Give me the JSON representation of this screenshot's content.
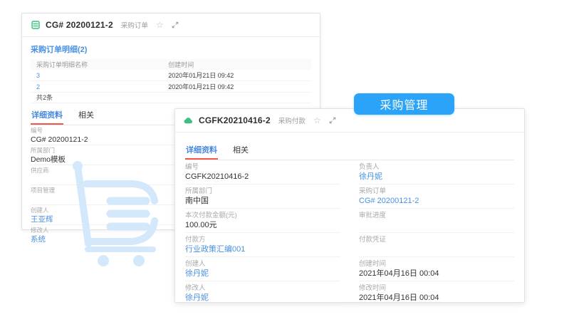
{
  "badge": {
    "label": "采购管理",
    "bg_color": "#2aa3f8"
  },
  "watermark": {
    "icon": "shopping-cart-icon",
    "color": "#d3e8fb"
  },
  "colors": {
    "link_blue": "#4a90e2",
    "tab_underline_red": "#f0564c",
    "object_icon_green": "#3fbf7f",
    "badge_blue": "#2aa3f8"
  },
  "back_card": {
    "header": {
      "icon": "form-grid-icon",
      "title": "CG# 20200121-2",
      "type_label": "采购订单",
      "actions": [
        "star-icon",
        "expand-icon"
      ]
    },
    "related_list": {
      "title": "采购订单明细(2)",
      "columns": [
        "采购订单明细名称",
        "创建时间"
      ],
      "rows": [
        [
          "3",
          "2020年01月21日 09:42"
        ],
        [
          "2",
          "2020年01月21日 09:42"
        ]
      ],
      "footer": "共2条"
    },
    "tabs": [
      {
        "label": "详细资料",
        "active": true
      },
      {
        "label": "相关",
        "active": false
      }
    ],
    "fields": [
      {
        "label": "编号",
        "value": "CG# 20200121-2",
        "link": false
      },
      {
        "label": "所属部门",
        "value": "Demo模板",
        "link": false
      },
      {
        "label": "供应商",
        "value": "",
        "link": false
      },
      {
        "label": "项目管理",
        "value": "",
        "link": false
      },
      {
        "label": "创建人",
        "value": "王亚辉",
        "link": true
      },
      {
        "label": "修改人",
        "value": "系统",
        "link": true
      }
    ]
  },
  "front_card": {
    "header": {
      "icon": "cloud-icon",
      "title": "CGFK20210416-2",
      "type_label": "采购付款",
      "actions": [
        "star-icon",
        "expand-icon"
      ]
    },
    "tabs": [
      {
        "label": "详细资料",
        "active": true
      },
      {
        "label": "相关",
        "active": false
      }
    ],
    "fields": [
      {
        "label": "编号",
        "value": "CGFK20210416-2",
        "link": false
      },
      {
        "label": "负责人",
        "value": "徐丹妮",
        "link": true
      },
      {
        "label": "所属部门",
        "value": "南中国",
        "link": false
      },
      {
        "label": "采购订单",
        "value": "CG# 20200121-2",
        "link": true
      },
      {
        "label": "本次付款金额(元)",
        "value": "100.00元",
        "link": false
      },
      {
        "label": "审批进度",
        "value": "",
        "link": false
      },
      {
        "label": "付款方",
        "value": "行业政策汇编001",
        "link": true
      },
      {
        "label": "付款凭证",
        "value": "",
        "link": false
      },
      {
        "label": "创建人",
        "value": "徐丹妮",
        "link": true
      },
      {
        "label": "创建时间",
        "value": "2021年04月16日 00:04",
        "link": false
      },
      {
        "label": "修改人",
        "value": "徐丹妮",
        "link": true
      },
      {
        "label": "修改时间",
        "value": "2021年04月16日 00:04",
        "link": false
      }
    ]
  }
}
